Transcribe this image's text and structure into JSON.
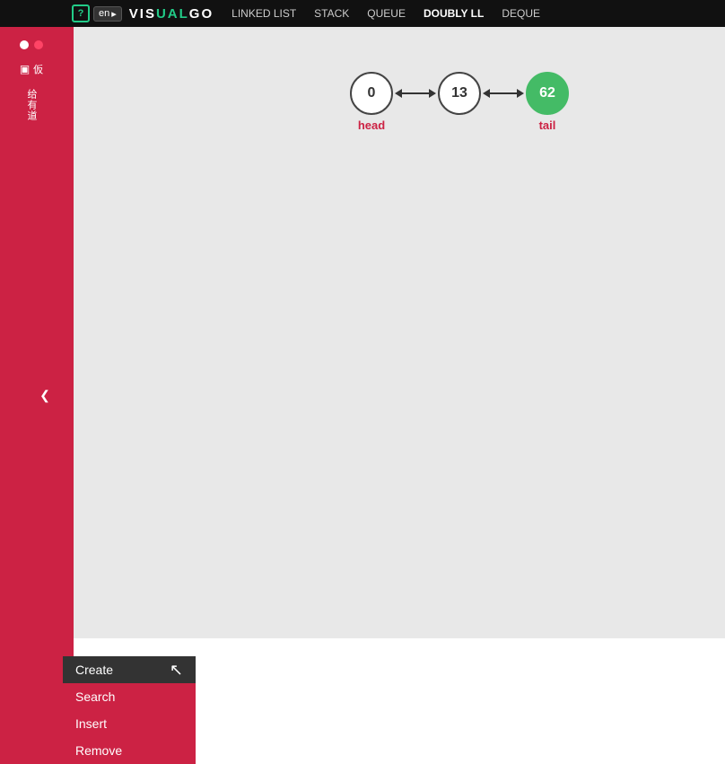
{
  "topnav": {
    "lang": "en",
    "brand": "VISUALGO",
    "nav_items": [
      {
        "label": "LINKED LIST",
        "active": false
      },
      {
        "label": "STACK",
        "active": false
      },
      {
        "label": "QUEUE",
        "active": false
      },
      {
        "label": "DOUBLY LL",
        "active": true
      },
      {
        "label": "DEQUE",
        "active": false
      }
    ]
  },
  "visualization": {
    "nodes": [
      {
        "value": "0",
        "type": "normal",
        "label": "head"
      },
      {
        "value": "13",
        "type": "normal",
        "label": ""
      },
      {
        "value": "62",
        "type": "tail",
        "label": "tail"
      }
    ]
  },
  "menu": {
    "items": [
      {
        "label": "Create",
        "type": "create"
      },
      {
        "label": "Search",
        "type": "search"
      },
      {
        "label": "Insert",
        "type": "insert"
      },
      {
        "label": "Remove",
        "type": "remove"
      }
    ]
  },
  "sidebar": {
    "arrow_label": "❮"
  },
  "colors": {
    "accent_red": "#cc2244",
    "accent_green": "#44bb66",
    "nav_bg": "#111111",
    "canvas_bg": "#e8e8e8"
  }
}
